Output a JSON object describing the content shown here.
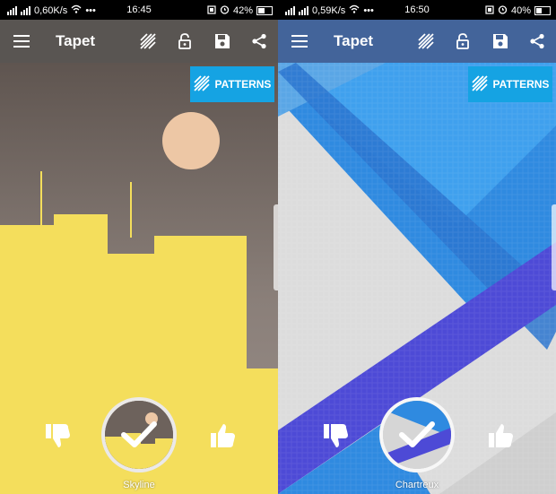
{
  "left_screen": {
    "status": {
      "net": "0,60K/s",
      "time": "16:45",
      "battery": "42%"
    },
    "toolbar_title": "Tapet",
    "patterns_label": "PATTERNS",
    "wallpaper_name": "Skyline",
    "battery_level": 0.42
  },
  "right_screen": {
    "status": {
      "net": "0,59K/s",
      "time": "16:50",
      "battery": "40%"
    },
    "toolbar_title": "Tapet",
    "patterns_label": "PATTERNS",
    "wallpaper_name": "Chartreux",
    "battery_level": 0.4
  },
  "icons": [
    "menu-icon",
    "patterns-icon",
    "lock-icon",
    "save-icon",
    "share-icon",
    "thumbs-down-icon",
    "check-icon",
    "thumbs-up-icon",
    "wifi-icon",
    "alarm-icon",
    "battery-icon",
    "signal-icon"
  ],
  "colors": {
    "skyline_sky": "#7b6f67",
    "skyline_buildings": "#f4de5c",
    "skyline_sun": "#edc7a5",
    "chartreux_blue": "#2f8ae0",
    "chartreux_purple": "#4d4ad6",
    "chartreux_grey": "#dcdcdc",
    "patterns_button": "#15a3e3"
  }
}
